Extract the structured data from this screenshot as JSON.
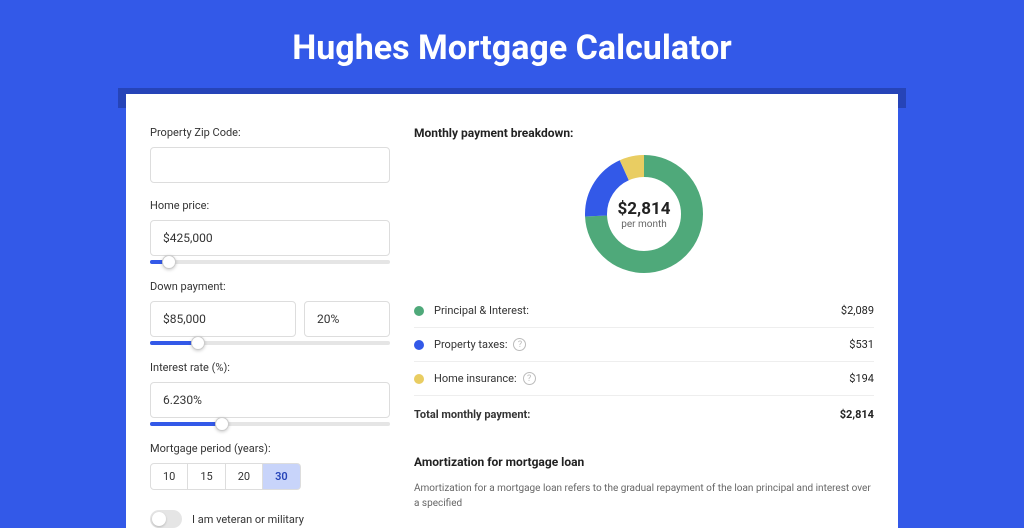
{
  "page_title": "Hughes Mortgage Calculator",
  "form": {
    "zip": {
      "label": "Property Zip Code:",
      "value": ""
    },
    "price": {
      "label": "Home price:",
      "value": "$425,000",
      "slider_pct": 8
    },
    "down": {
      "label": "Down payment:",
      "value": "$85,000",
      "pct_value": "20%",
      "slider_pct": 20
    },
    "rate": {
      "label": "Interest rate (%):",
      "value": "6.230%",
      "slider_pct": 30
    },
    "period": {
      "label": "Mortgage period (years):",
      "options": [
        "10",
        "15",
        "20",
        "30"
      ],
      "selected": "30"
    },
    "veteran_label": "I am veteran or military"
  },
  "breakdown": {
    "heading": "Monthly payment breakdown:",
    "center_value": "$2,814",
    "center_label": "per month",
    "items": [
      {
        "label": "Principal & Interest:",
        "value": "$2,089",
        "color": "#4fa97a",
        "info": false,
        "share": 74.2
      },
      {
        "label": "Property taxes:",
        "value": "$531",
        "color": "#3359e8",
        "info": true,
        "share": 18.9
      },
      {
        "label": "Home insurance:",
        "value": "$194",
        "color": "#e9cd62",
        "info": true,
        "share": 6.9
      }
    ],
    "total_label": "Total monthly payment:",
    "total_value": "$2,814"
  },
  "amort": {
    "heading": "Amortization for mortgage loan",
    "text": "Amortization for a mortgage loan refers to the gradual repayment of the loan principal and interest over a specified"
  },
  "chart_data": {
    "type": "pie",
    "title": "Monthly payment breakdown",
    "series": [
      {
        "name": "Principal & Interest",
        "value": 2089,
        "color": "#4fa97a"
      },
      {
        "name": "Property taxes",
        "value": 531,
        "color": "#3359e8"
      },
      {
        "name": "Home insurance",
        "value": 194,
        "color": "#e9cd62"
      }
    ],
    "total": 2814,
    "unit": "USD per month"
  }
}
